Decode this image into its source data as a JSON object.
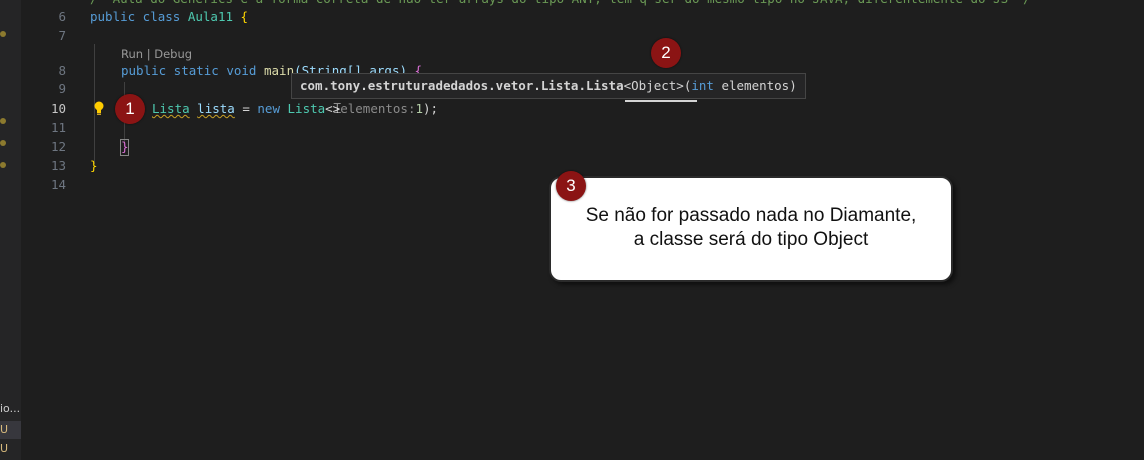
{
  "sidebar": {
    "truncated_label": "io...",
    "status_markers": [
      "U",
      "U"
    ]
  },
  "editor": {
    "line_numbers": [
      "6",
      "7",
      "8",
      "9",
      "10",
      "11",
      "12",
      "13",
      "14"
    ],
    "active_line": "10",
    "code": {
      "top_comment": "/* Aula do Generics e a forma correta de não ter arrays do tipo ANY, tem q ser do mesmo tipo no JAVA, diferentemente do JS */",
      "line6": {
        "kw": "public class",
        "name": "Aula11",
        "brace": "{"
      },
      "codelens": "Run | Debug",
      "line8": {
        "kw": "public static void",
        "fn": "main",
        "params": "(String[] args)",
        "brace": "{"
      },
      "line10": {
        "type": "Lista",
        "var": "lista",
        "op": "=",
        "kw_new": "new",
        "ctor": "Lista",
        "diamond": "<>",
        "param_hint": "elementos:",
        "arg": "1",
        "end": ");"
      },
      "line12": {
        "brace": "}"
      },
      "line13": {
        "brace": "}"
      }
    }
  },
  "hover_tooltip": {
    "signature_bold": "com.tony.estruturadedados.vetor.Lista.Lista",
    "signature_generic": "<Object>",
    "signature_params_open": "(",
    "param_type": "int",
    "param_name": " elementos)"
  },
  "annotations": {
    "badge1": "1",
    "badge2": "2",
    "badge3": "3",
    "callout_line1": "Se não for passado nada no Diamante,",
    "callout_line2": "a classe será do tipo Object"
  },
  "colors": {
    "badge": "#8b1414",
    "editor_bg": "#1e1e1e"
  }
}
